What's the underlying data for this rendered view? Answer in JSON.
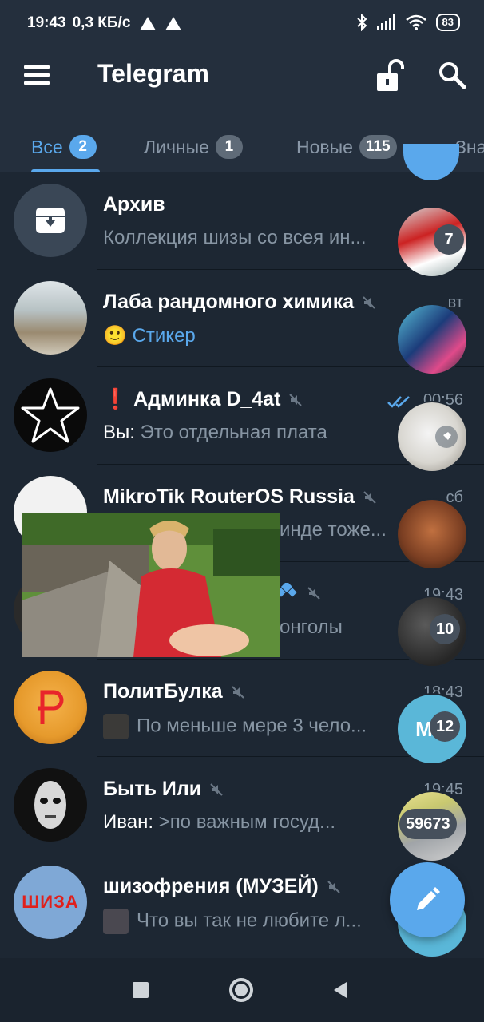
{
  "statusbar": {
    "time": "19:43",
    "speed": "0,3 КБ/с",
    "battery": "83"
  },
  "header": {
    "title": "Telegram"
  },
  "tabs": [
    {
      "label": "Все",
      "badge": "2",
      "active": true
    },
    {
      "label": "Личные",
      "badge": "1",
      "active": false
    },
    {
      "label": "Новые",
      "badge": "115",
      "active": false
    },
    {
      "label": "Зна",
      "badge": "",
      "active": false
    }
  ],
  "chats": [
    {
      "name": "Архив",
      "message": "Коллекция шизы со всея ин...",
      "time": ""
    },
    {
      "name": "Лаба рандомного химика",
      "sender": "",
      "emoji": "🙂",
      "message": "Стикер",
      "time": "вт"
    },
    {
      "name": "❗ Админка D_4at",
      "sender": "Вы:",
      "message": "Это отдельная плата",
      "time": "00:56"
    },
    {
      "name": "MikroTik RouterOS Russia",
      "message": "инде тоже...",
      "time": "сб"
    },
    {
      "name": "",
      "message": "онголы",
      "time": "19:43"
    },
    {
      "name": "ПолитБулка",
      "message": "По меньше мере 3 чело...",
      "time": "18:43"
    },
    {
      "name": "Быть Или",
      "sender": "Иван:",
      "message": ">по важным госуд...",
      "time": "19:45"
    },
    {
      "name": "шизофрения (МУЗЕЙ)",
      "message": "Что вы так не любите л...",
      "time": ""
    }
  ],
  "bubbles": {
    "b1": "7",
    "b4": "10",
    "b5": "12",
    "b5_letter": "M",
    "b6": "59673"
  },
  "avatar_text": {
    "shiza": "ШИЗА"
  },
  "colors": {
    "accent": "#5aa8ec",
    "background": "#1d2733",
    "header": "#242f3d"
  }
}
